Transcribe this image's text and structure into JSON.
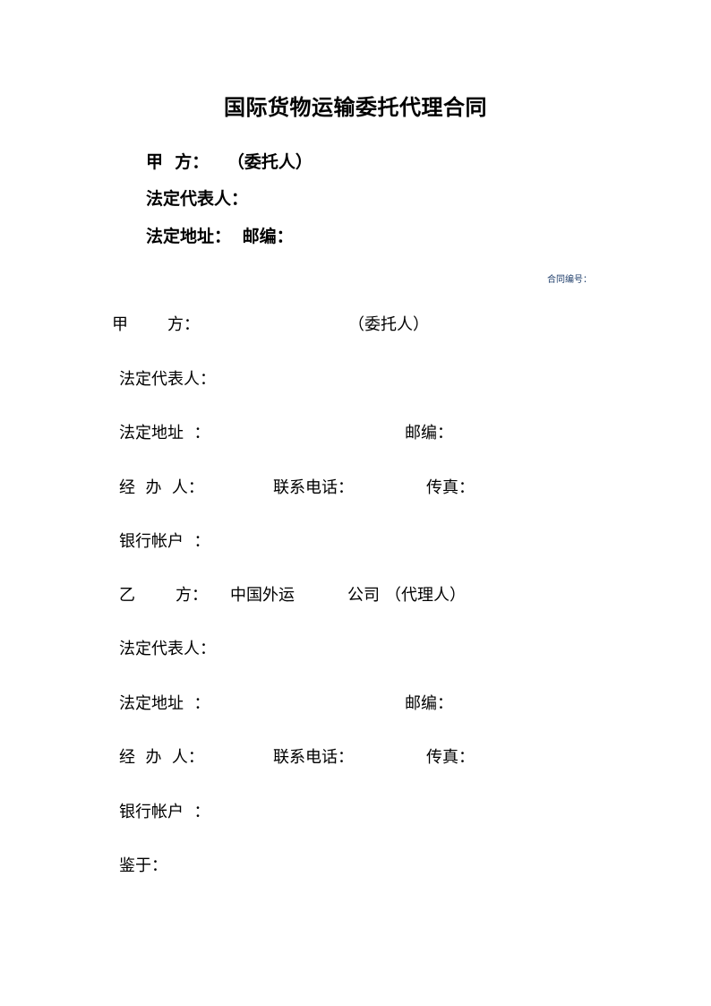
{
  "document": {
    "title": "国际货物运输委托代理合同",
    "header": {
      "party_a_label": "甲  方：",
      "party_a_role": "（委托人）",
      "legal_rep": "法定代表人：",
      "legal_address": "法定地址：",
      "postcode": "邮编："
    },
    "contract_number_label": "合同编号：",
    "party_a": {
      "label_char1": "甲",
      "label_char2": "方：",
      "role": "（委托人）",
      "legal_rep": "法定代表人：",
      "legal_address": "法定地址  ：",
      "postcode": "邮编：",
      "handler": "经  办  人：",
      "phone": "联系电话：",
      "fax": "传真：",
      "bank_account": "银行帐户  ："
    },
    "party_b": {
      "label_char1": "乙",
      "label_char2": "方：",
      "company_prefix": "中国外运",
      "company_suffix": "公司",
      "role": "（代理人）",
      "legal_rep": "法定代表人：",
      "legal_address": "法定地址  ：",
      "postcode": "邮编：",
      "handler": "经  办  人：",
      "phone": "联系电话：",
      "fax": "传真：",
      "bank_account": "银行帐户  ："
    },
    "whereas": "鉴于："
  }
}
